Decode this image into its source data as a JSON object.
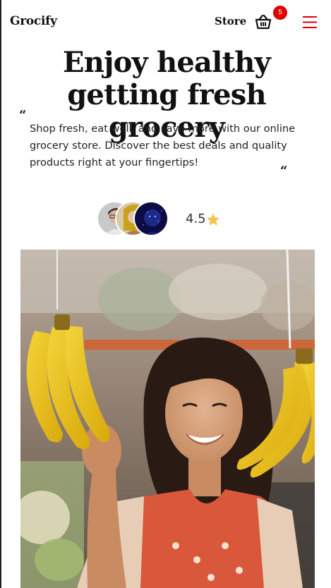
{
  "navbar": {
    "brand": "Grocify",
    "store_label": "Store",
    "cart_count": "5",
    "cart_icon": "shopping-basket-icon",
    "menu_icon": "hamburger-menu-icon",
    "accent_color": "#e00000"
  },
  "hero": {
    "title": "Enjoy healthy getting fresh grocery",
    "open_quote": "“",
    "close_quote": "“",
    "description": "Shop fresh, eat well, and save more with our online grocery store. Discover the best deals and quality products right at your fingertips!",
    "photo_alt": "Woman smiling while holding bananas at a market"
  },
  "social_proof": {
    "rating": "4.5",
    "star_icon": "star-icon",
    "star_color": "#f5c451"
  }
}
